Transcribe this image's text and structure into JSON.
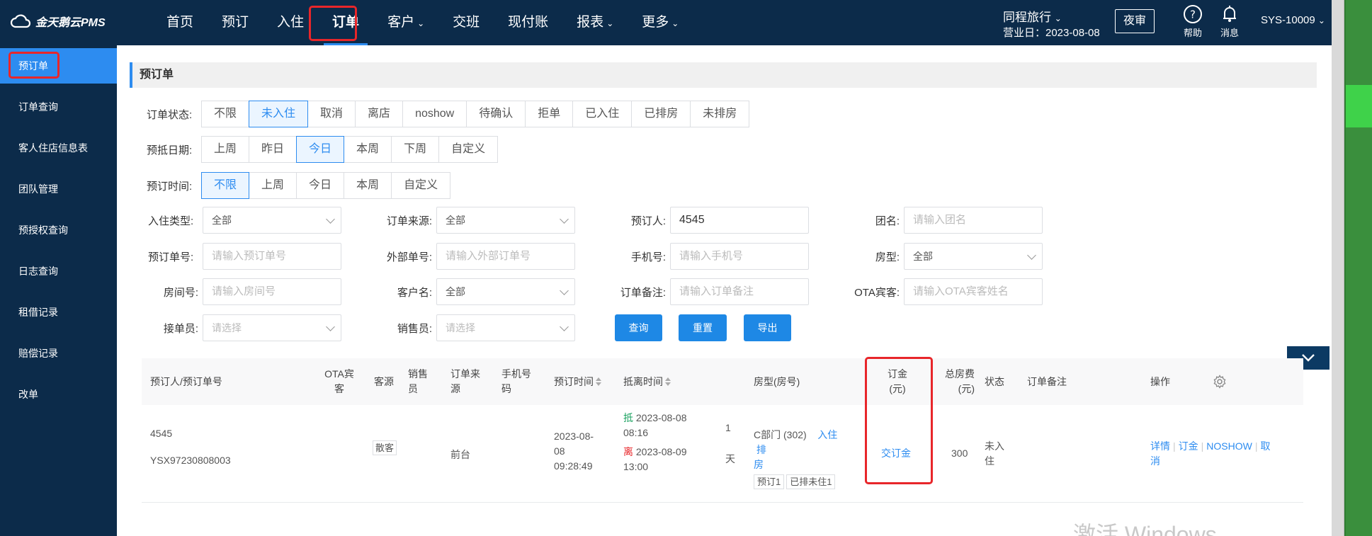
{
  "brand": {
    "name": "金天鹅云PMS"
  },
  "nav": [
    {
      "label": "首页",
      "dropdown": false
    },
    {
      "label": "预订",
      "dropdown": false
    },
    {
      "label": "入住",
      "dropdown": false
    },
    {
      "label": "订单",
      "dropdown": false,
      "active": true
    },
    {
      "label": "客户",
      "dropdown": true
    },
    {
      "label": "交班",
      "dropdown": false
    },
    {
      "label": "现付账",
      "dropdown": false
    },
    {
      "label": "报表",
      "dropdown": true
    },
    {
      "label": "更多",
      "dropdown": true
    }
  ],
  "header": {
    "hotel": "同程旅行",
    "business_date": "营业日：2023-08-08",
    "night_audit": "夜审",
    "help": "帮助",
    "messages": "消息",
    "user": "SYS-10009"
  },
  "sidebar": {
    "items": [
      {
        "label": "预订单",
        "active": true
      },
      {
        "label": "订单查询"
      },
      {
        "label": "客人住店信息表"
      },
      {
        "label": "团队管理"
      },
      {
        "label": "预授权查询"
      },
      {
        "label": "日志查询"
      },
      {
        "label": "租借记录"
      },
      {
        "label": "赔偿记录"
      },
      {
        "label": "改单"
      }
    ]
  },
  "page": {
    "title": "预订单"
  },
  "filters": {
    "order_status": {
      "label": "订单状态:",
      "options": [
        "不限",
        "未入住",
        "取消",
        "离店",
        "noshow",
        "待确认",
        "拒单",
        "已入住",
        "已排房",
        "未排房"
      ],
      "selected": "未入住"
    },
    "arrival_date": {
      "label": "预抵日期:",
      "options": [
        "上周",
        "昨日",
        "今日",
        "本周",
        "下周",
        "自定义"
      ],
      "selected": "今日"
    },
    "booking_time": {
      "label": "预订时间:",
      "options": [
        "不限",
        "上周",
        "今日",
        "本周",
        "自定义"
      ],
      "selected": "不限"
    }
  },
  "form": {
    "checkin_type": {
      "label": "入住类型:",
      "value": "全部"
    },
    "order_source": {
      "label": "订单来源:",
      "value": "全部"
    },
    "booker": {
      "label": "预订人:",
      "value": "4545"
    },
    "group_name": {
      "label": "团名:",
      "placeholder": "请输入团名"
    },
    "booking_no": {
      "label": "预订单号:",
      "placeholder": "请输入预订单号"
    },
    "external_no": {
      "label": "外部单号:",
      "placeholder": "请输入外部订单号"
    },
    "phone": {
      "label": "手机号:",
      "placeholder": "请输入手机号"
    },
    "room_type": {
      "label": "房型:",
      "value": "全部"
    },
    "room_no": {
      "label": "房间号:",
      "placeholder": "请输入房间号"
    },
    "customer_name": {
      "label": "客户名:",
      "value": "全部"
    },
    "order_note": {
      "label": "订单备注:",
      "placeholder": "请输入订单备注"
    },
    "ota_guest": {
      "label": "OTA宾客:",
      "placeholder": "请输入OTA宾客姓名"
    },
    "receiver": {
      "label": "接单员:",
      "placeholder": "请选择"
    },
    "salesperson": {
      "label": "销售员:",
      "placeholder": "请选择"
    }
  },
  "actions": {
    "query": "查询",
    "reset": "重置",
    "export": "导出"
  },
  "table": {
    "headers": {
      "booker": "预订人/预订单号",
      "ota_guest_1": "OTA宾",
      "ota_guest_2": "客",
      "source": "客源",
      "sales_1": "销售",
      "sales_2": "员",
      "order_source_1": "订单来",
      "order_source_2": "源",
      "phone_1": "手机号",
      "phone_2": "码",
      "booking_time": "预订时间",
      "arrival_departure": "抵离时间",
      "room": "房型(房号)",
      "deposit_1": "订金",
      "deposit_2": "(元)",
      "total_1": "总房费",
      "total_2": "(元)",
      "status": "状态",
      "note": "订单备注",
      "ops": "操作"
    },
    "rows": [
      {
        "booker": "4545",
        "booking_no": "YSX97230808003",
        "source": "散客",
        "order_source": "前台",
        "booking_time_1": "2023-08-",
        "booking_time_2": "08",
        "booking_time_3": "09:28:49",
        "arrive_mark": "抵",
        "arrive_date": "2023-08-08",
        "arrive_time": "08:16",
        "depart_mark": "离",
        "depart_date": "2023-08-09",
        "depart_time": "13:00",
        "nights": "1",
        "nights_unit": "天",
        "room": "C部门 (302)",
        "checkin_link": "入住",
        "assign_link_1": "排",
        "assign_link_2": "房",
        "tag1": "预订1",
        "tag2": "已排未住1",
        "deposit_link": "交订金",
        "total": "300",
        "status_1": "未入",
        "status_2": "住",
        "op_detail": "详情",
        "op_deposit": "订金",
        "op_noshow": "NOSHOW",
        "op_cancel_1": "取",
        "op_cancel_2": "消"
      }
    ]
  },
  "watermark": "激活 Windows",
  "colors": {
    "nav_bg": "#0c2b4a",
    "accent": "#2d8cf0",
    "highlight_box": "#e8262a"
  }
}
